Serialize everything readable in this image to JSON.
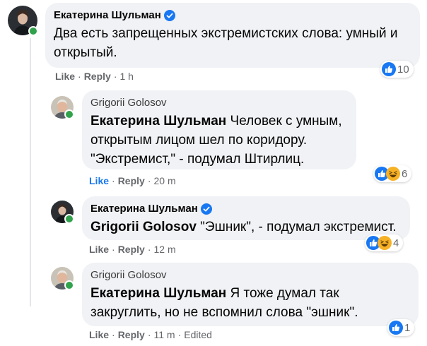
{
  "comments": [
    {
      "author": "Екатерина Шульман",
      "verified": true,
      "text": "Два есть запрещенных экстремистских слова: умный и открытый.",
      "actions": {
        "like": "Like",
        "reply": "Reply",
        "time": "1 h"
      },
      "reactions": {
        "count": "10",
        "types": [
          "like-icon"
        ]
      }
    },
    {
      "author": "Grigorii Golosov",
      "mention": "Екатерина Шульман",
      "text": " Человек с умным, открытым лицом шел по коридору. \"Экстремист,\" - подумал Штирлиц.",
      "actions": {
        "like": "Like",
        "reply": "Reply",
        "time": "20 m"
      },
      "reactions": {
        "count": "6",
        "types": [
          "like-icon",
          "haha-icon"
        ]
      }
    },
    {
      "author": "Екатерина Шульман",
      "verified": true,
      "mention": "Grigorii Golosov",
      "text": " \"Эшник\", - подумал экстремист.",
      "actions": {
        "like": "Like",
        "reply": "Reply",
        "time": "12 m"
      },
      "reactions": {
        "count": "4",
        "types": [
          "like-icon",
          "haha-icon"
        ]
      }
    },
    {
      "author": "Grigorii Golosov",
      "mention": "Екатерина Шульман",
      "text": " Я тоже думал так закруглить, но не вспомнил слова \"эшник\".",
      "actions": {
        "like": "Like",
        "reply": "Reply",
        "time": "11 m",
        "edited": "Edited"
      },
      "reactions": {
        "count": "1",
        "types": [
          "like-icon"
        ]
      }
    }
  ],
  "separators": {
    "dot": "·"
  },
  "colors": {
    "bubble": "#f0f2f5",
    "like_blue": "#1877f2",
    "meta_gray": "#65676b",
    "online": "#31a24c",
    "haha": "#f7b125"
  }
}
